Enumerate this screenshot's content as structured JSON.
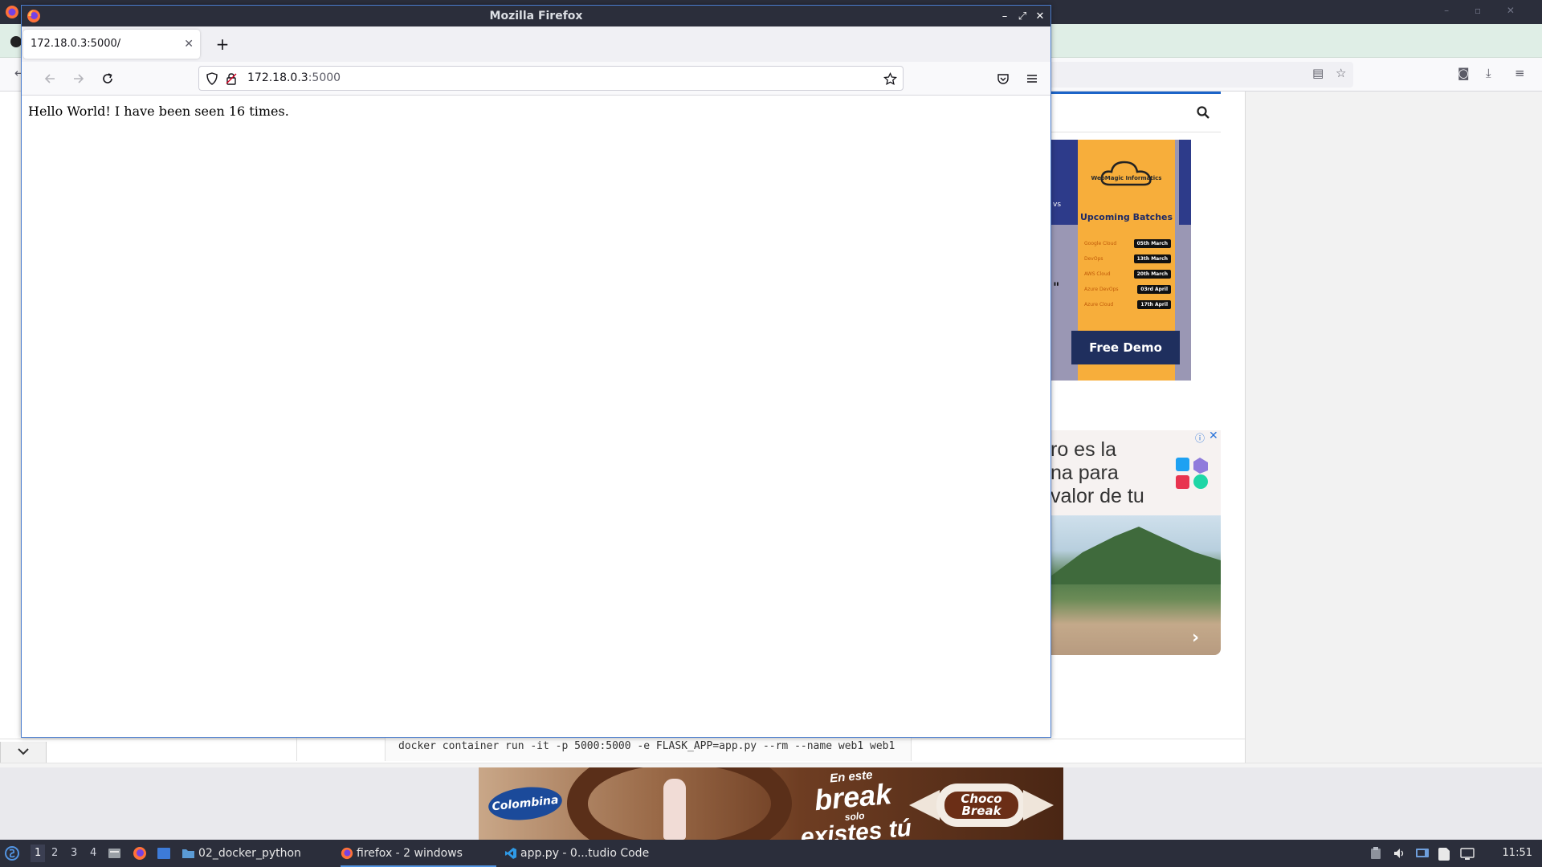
{
  "background_window": {
    "cmd": "docker container run -it -p 5000:5000 -e FLASK_APP=app.py --rm --name web1 web1",
    "ad_batches": {
      "brand": "WebMagic Informatics",
      "heading": "Upcoming Batches",
      "rows": [
        {
          "course": "Google Cloud",
          "date": "05th March"
        },
        {
          "course": "DevOps",
          "date": "13th March"
        },
        {
          "course": "AWS Cloud",
          "date": "20th March"
        },
        {
          "course": "Azure DevOps",
          "date": "03rd April"
        },
        {
          "course": "Azure Cloud",
          "date": "17th April"
        }
      ],
      "cta": "Free Demo",
      "side_text": "vs",
      "quote_mark": "\""
    },
    "ad_spanish": {
      "lines": [
        "ro es la",
        "na para",
        "valor de tu"
      ]
    },
    "ad_choco": {
      "brand": "Colombina",
      "slogan_1": "En este",
      "slogan_2": "break",
      "slogan_3": "solo",
      "slogan_4": "existes tú",
      "candy": "Choco Break"
    }
  },
  "firefox": {
    "window_title": "Mozilla Firefox",
    "tab_title": "172.18.0.3:5000/",
    "url_host": "172.18.0.3",
    "url_port": ":5000",
    "page_text": "Hello World! I have been seen 16 times."
  },
  "taskbar": {
    "workspaces": [
      "1",
      "2",
      "3",
      "4"
    ],
    "tasks": {
      "files": "02_docker_python",
      "firefox": "firefox - 2 windows",
      "vscode": "app.py - 0...tudio Code"
    },
    "clock": "11:51"
  },
  "colors": {
    "taskbar": "#2b2e3b",
    "accent": "#5294e2",
    "window_border": "#4a7dcf"
  }
}
